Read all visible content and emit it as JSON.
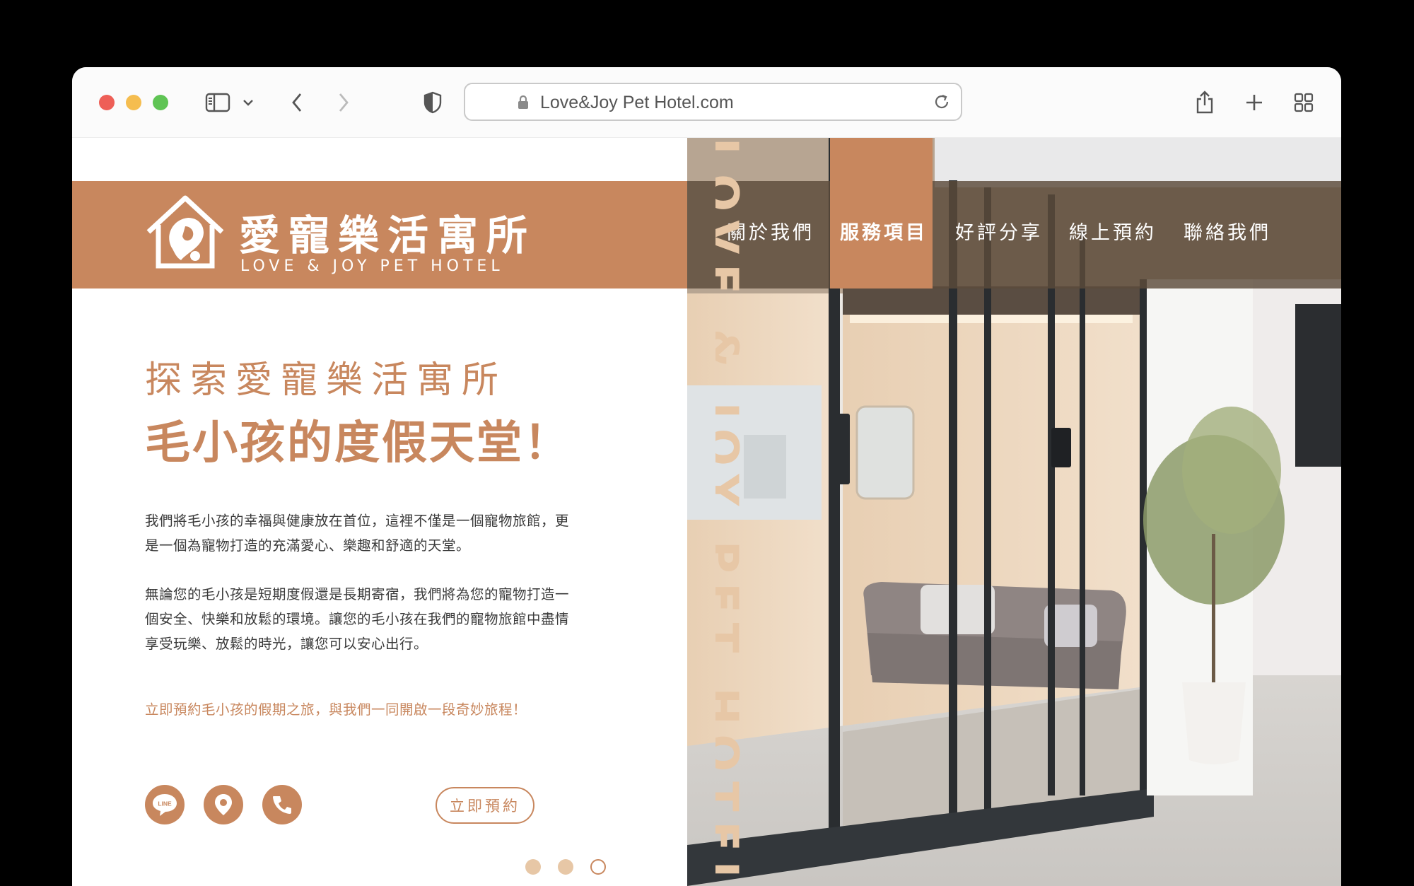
{
  "browser": {
    "url": "Love&Joy Pet Hotel.com"
  },
  "header": {
    "logo_zh": "愛寵樂活寓所",
    "logo_en": "LOVE & JOY PET HOTEL",
    "nav": [
      {
        "label": "關於我們",
        "active": false
      },
      {
        "label": "服務項目",
        "active": true
      },
      {
        "label": "好評分享",
        "active": false
      },
      {
        "label": "線上預約",
        "active": false
      },
      {
        "label": "聯絡我們",
        "active": false
      }
    ]
  },
  "hero": {
    "subtitle": "探索愛寵樂活寓所",
    "title": "毛小孩的度假天堂！",
    "paragraph1": "我們將毛小孩的幸福與健康放在首位，這裡不僅是一個寵物旅館，更是一個為寵物打造的充滿愛心、樂趣和舒適的天堂。",
    "paragraph2": "無論您的毛小孩是短期度假還是長期寄宿，我們將為您的寵物打造一個安全、快樂和放鬆的環境。讓您的毛小孩在我們的寵物旅館中盡情享受玩樂、放鬆的時光，讓您可以安心出行。",
    "cta_text": "立即預約毛小孩的假期之旅，與我們一同開啟一段奇妙旅程！",
    "book_button": "立即預約",
    "vertical_text": "LOVE & JOY PET HOTEL",
    "line_label": "LINE",
    "carousel": {
      "total": 3,
      "active": 3
    }
  },
  "colors": {
    "brand": "#c8875e",
    "brand_light": "#e7c7a6",
    "nav_bg": "#5c4a3a"
  }
}
